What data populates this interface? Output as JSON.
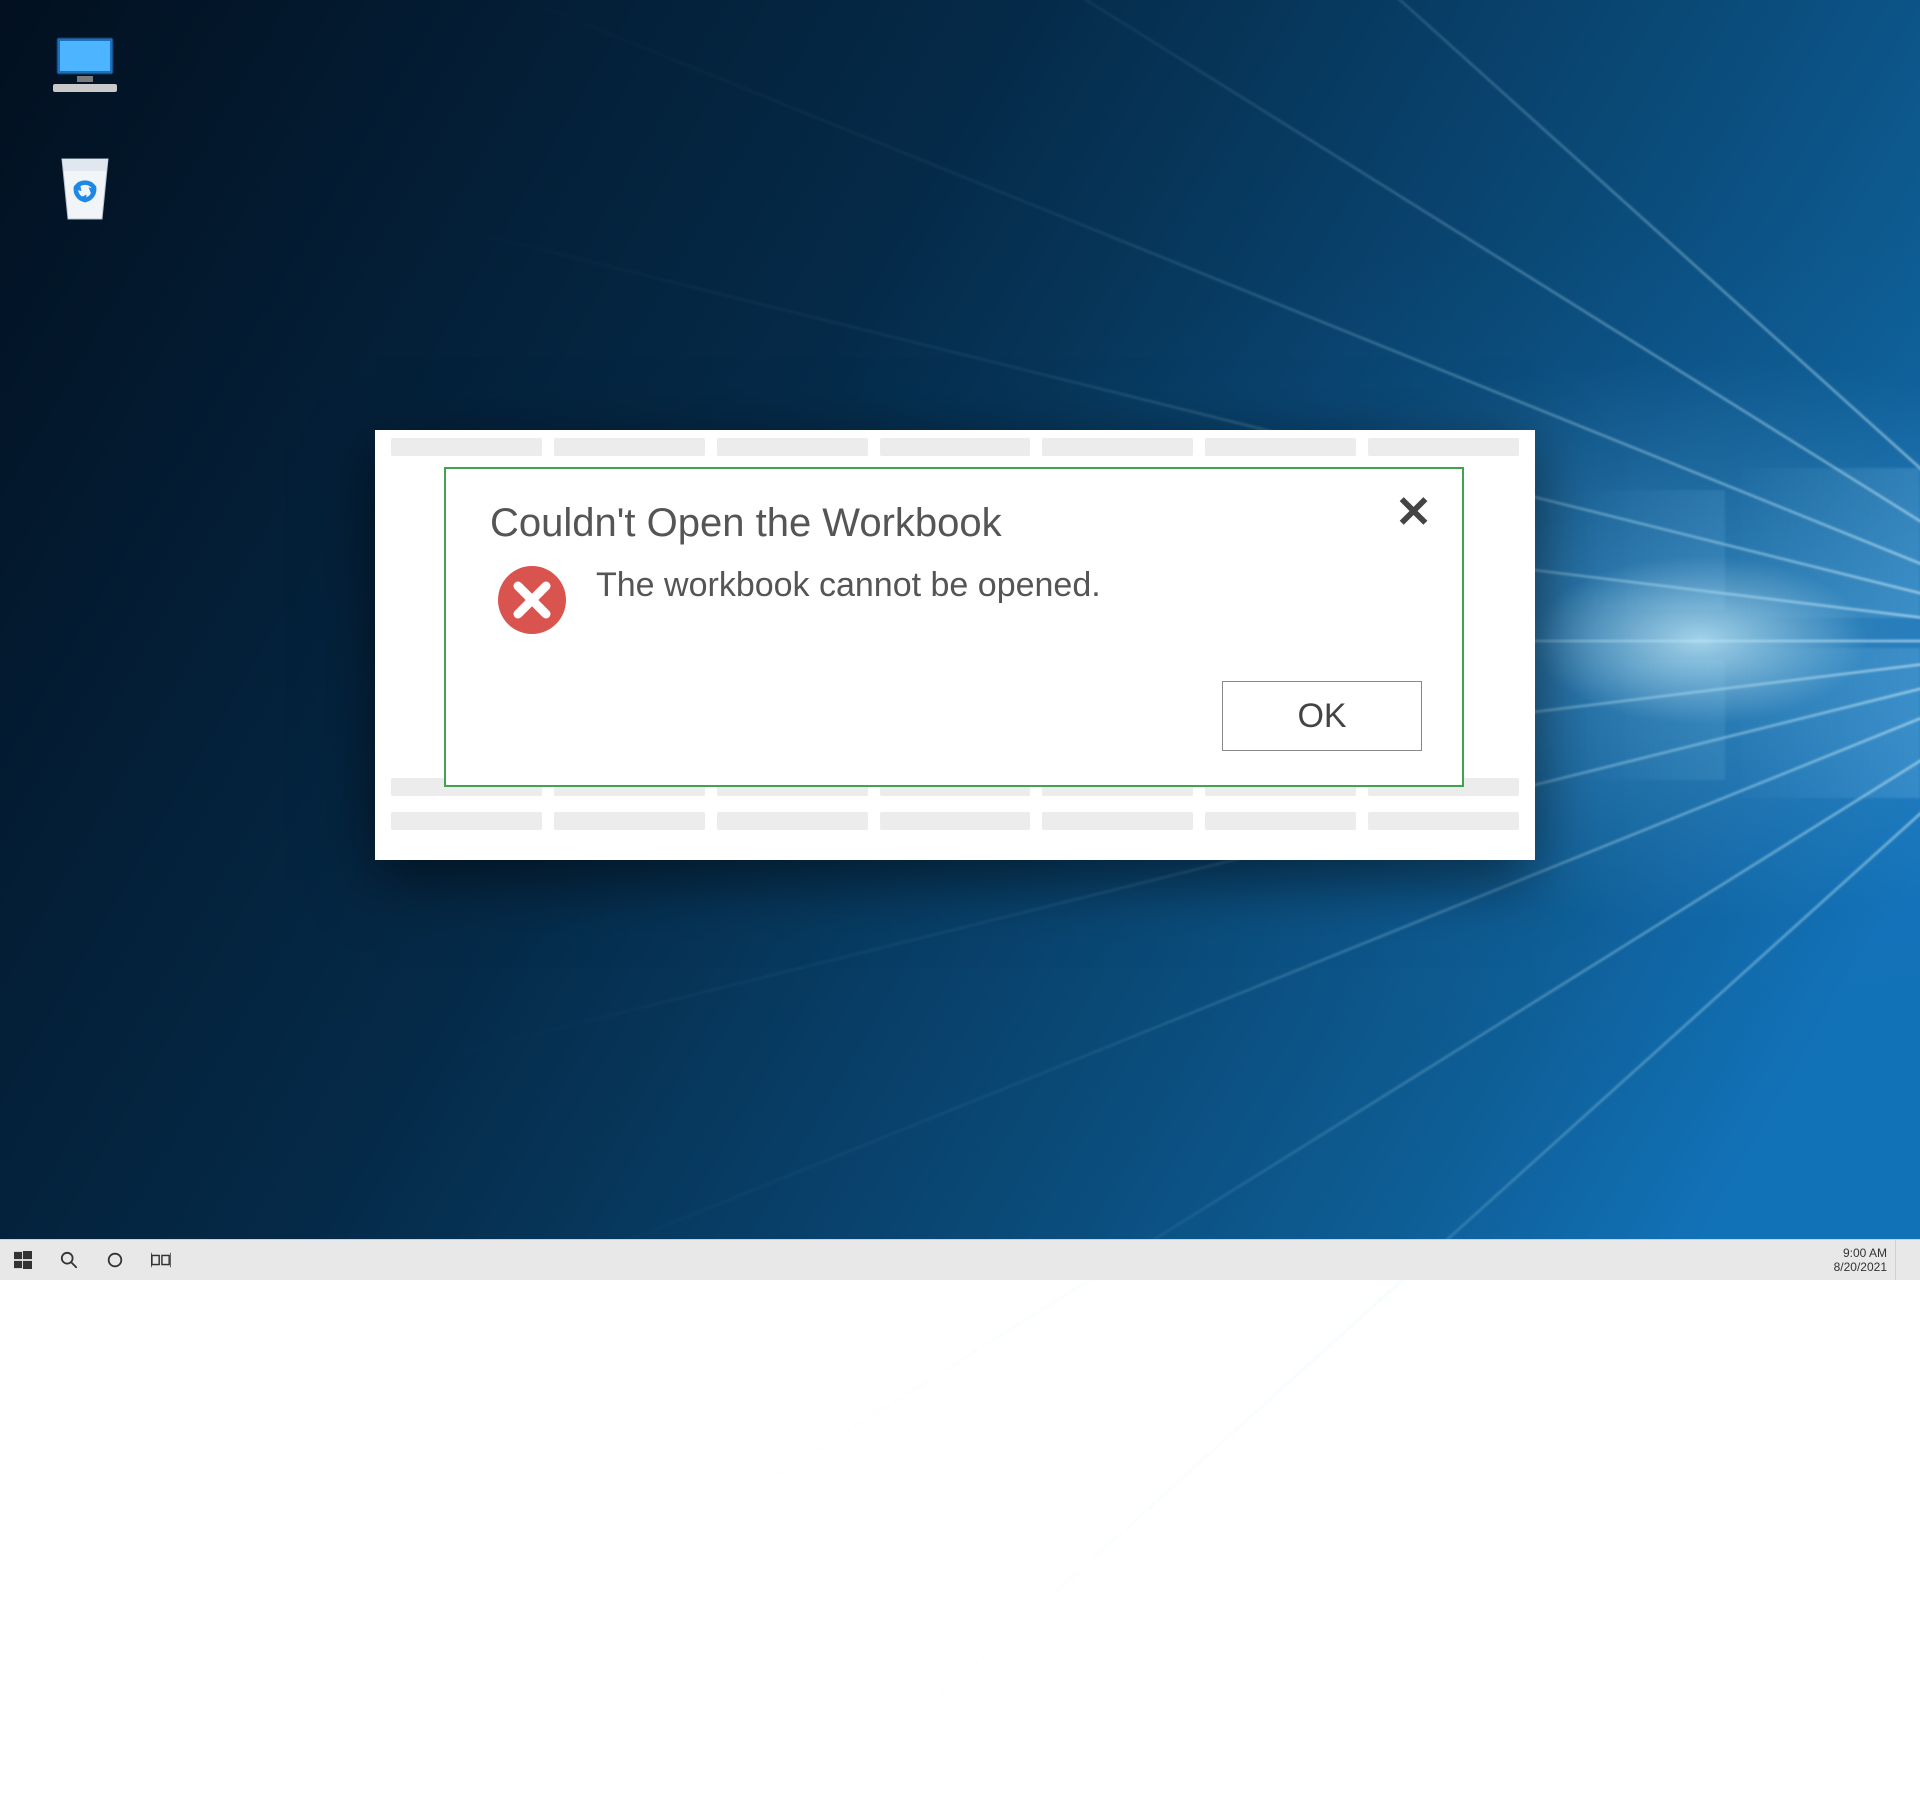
{
  "dialog": {
    "title": "Couldn't Open the Workbook",
    "message": "The workbook cannot be opened.",
    "ok_label": "OK",
    "accent": "#3fa352",
    "error_icon_color": "#d9534f"
  },
  "desktop_icons": {
    "this_pc_label": "",
    "recycle_bin_label": ""
  },
  "taskbar": {
    "time": "9:00 AM",
    "date": "8/20/2021"
  }
}
